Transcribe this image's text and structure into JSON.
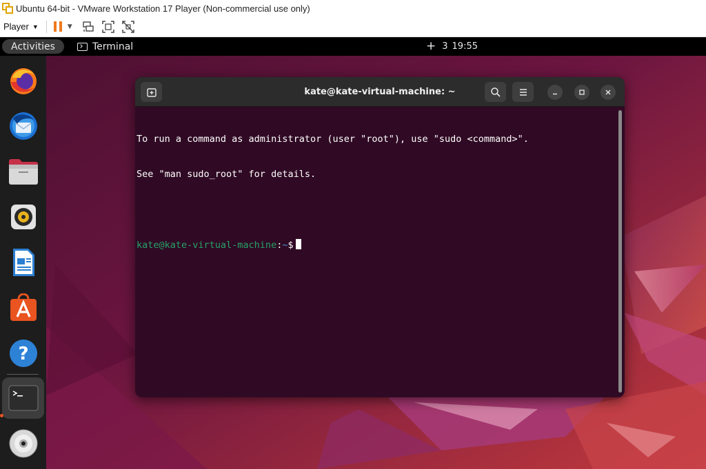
{
  "vmware": {
    "window_title": "Ubuntu 64-bit - VMware Workstation 17 Player (Non-commercial use only)",
    "player_menu": "Player",
    "toolbar_icons": [
      "pause-icon",
      "send-ctrl-alt-del-icon",
      "fullscreen-icon",
      "unity-icon"
    ],
    "accent": "#f07a1c"
  },
  "topbar": {
    "activities": "Activities",
    "app_name": "Terminal",
    "workspace_count": "3",
    "time": "19:55"
  },
  "dock": {
    "items": [
      "Firefox",
      "Thunderbird",
      "Files",
      "Rhythmbox",
      "LibreOffice Writer",
      "Ubuntu Software",
      "Help",
      "Terminal",
      "CD/DVD"
    ],
    "active_item": "Terminal"
  },
  "terminal": {
    "title": "kate@kate-virtual-machine: ~",
    "lines": [
      "To run a command as administrator (user \"root\"), use \"sudo <command>\".",
      "See \"man sudo_root\" for details."
    ],
    "prompt_user": "kate@kate-virtual-machine",
    "prompt_sep": ":",
    "prompt_path": "~",
    "prompt_symbol": "$",
    "colors": {
      "background": "#300a24",
      "prompt_user": "#26a269",
      "prompt_path": "#4e8ed9"
    }
  }
}
